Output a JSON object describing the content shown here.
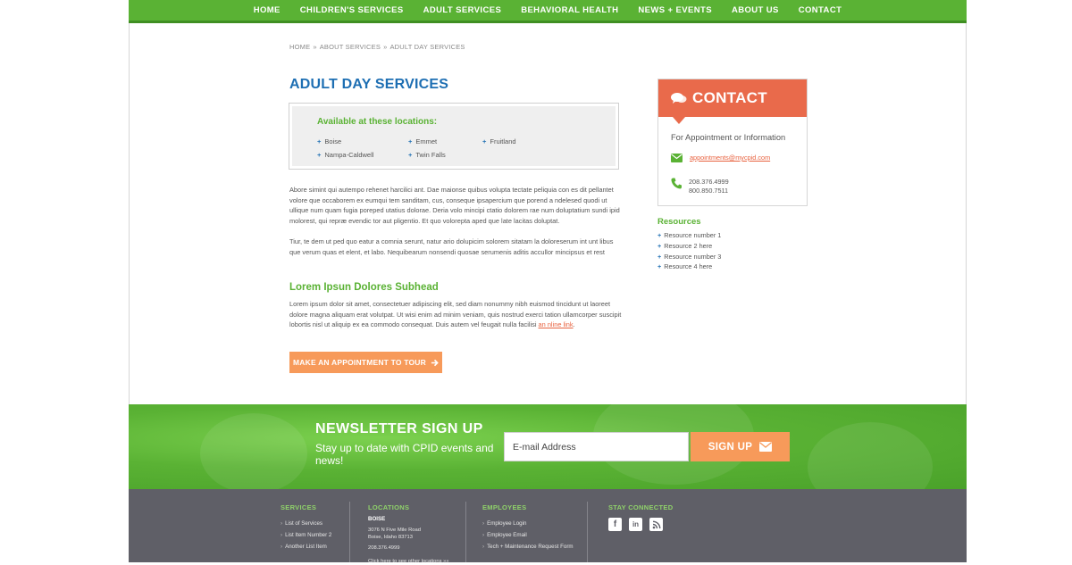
{
  "nav": [
    "HOME",
    "CHILDREN'S SERVICES",
    "ADULT SERVICES",
    "BEHAVIORAL HEALTH",
    "NEWS + EVENTS",
    "ABOUT US",
    "CONTACT"
  ],
  "breadcrumb": [
    "HOME",
    "ABOUT SERVICES",
    "ADULT DAY SERVICES"
  ],
  "breadcrumb_sep": "»",
  "page_title": "ADULT DAY SERVICES",
  "locations": {
    "heading": "Available at these locations:",
    "items": [
      "Boise",
      "Emmet",
      "Fruitland",
      "Nampa-Caldwell",
      "Twin Falls"
    ]
  },
  "body": {
    "para1": "Abore simint qui autempo rehenet harcilici ant. Dae maionse quibus volupta tectate peliquia con es dit pellantet volore que occaborem ex eumqui tem sanditam, cus, conseque ipsapercium que porend a ndelesed quodi ut ullique num quam fugia poreped utatius dolorae. Deria volo mincipi ctatio dolorem rae num doluptatium sundi ipid molorest, qui repræ evendic tor aut pligentio. Et quo volorepta aped que late lacitas doluptat.",
    "para2": "Tiur, te dem ut ped quo eatur a comnia serunt, natur ario dolupicim solorem sitatam la doloreserum int unt libus que verum quas et elent, et labo. Nequibearum nonsendi quosae serumenis aditis accullor mincipsus et rest",
    "subhead": "Lorem Ipsun Dolores Subhead",
    "para3": "Lorem ipsum dolor sit amet, consectetuer adipiscing elit, sed diam nonummy nibh euismod tincidunt ut laoreet dolore magna aliquam erat volutpat. Ut wisi enim ad minim veniam, quis nostrud exerci tation ullamcorper suscipit lobortis nisl ut aliquip ex ea commodo consequat. Duis autem vel feugait nulla facilisi",
    "inline_link": "an nline link",
    "period": ".",
    "cta": "MAKE AN APPOINTMENT TO TOUR"
  },
  "contact": {
    "title": "CONTACT",
    "subtitle": "For Appointment or Information",
    "email": "appointments@mycpid.com",
    "phone1": "208.376.4999",
    "phone2": "800.850.7511"
  },
  "resources": {
    "heading": "Resources",
    "items": [
      "Resource number 1",
      "Resource 2 here",
      "Resource number 3",
      "Resource 4 here"
    ]
  },
  "newsletter": {
    "title": "NEWSLETTER SIGN UP",
    "subtitle": "Stay up to date with CPID events and news!",
    "placeholder": "E-mail Address",
    "button": "SIGN UP"
  },
  "footer": {
    "services": {
      "heading": "SERVICES",
      "items": [
        "List of Services",
        "List Item Number 2",
        "Another List Item"
      ]
    },
    "locations": {
      "heading": "LOCATIONS",
      "city": "BOISE",
      "address1": "3076 N Five Mile Road",
      "address2": "Boise, Idaho 83713",
      "phone": "208.376.4999",
      "more": "Click here to see other locations »»"
    },
    "employees": {
      "heading": "EMPLOYEES",
      "items": [
        "Employee Login",
        "Employee Email",
        "Tech + Maintenance Request Form"
      ]
    },
    "connect": {
      "heading": "STAY CONNECTED",
      "icons": [
        "facebook-icon",
        "linkedin-icon",
        "rss-icon"
      ]
    }
  },
  "colors": {
    "green": "#5ab234",
    "blue": "#1e6fb3",
    "orange": "#f79a5a",
    "coral": "#e96a4b",
    "footer": "#5f5f67"
  }
}
